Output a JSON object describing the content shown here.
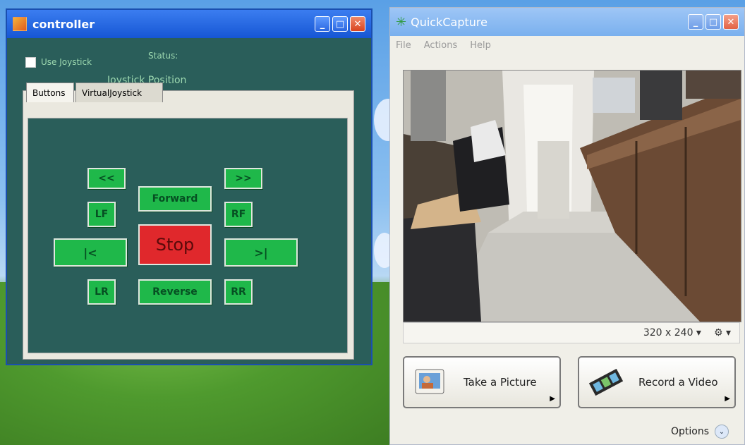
{
  "controller": {
    "title": "controller",
    "use_joystick_label": "Use Joystick",
    "status_label": "Status:",
    "joystick_position_label": "Joystick Position",
    "tabs": [
      "Buttons",
      "VirtualJoystick"
    ],
    "buttons": {
      "rewind": "<<",
      "fast_forward": ">>",
      "forward": "Forward",
      "lf": "LF",
      "rf": "RF",
      "left": "|<",
      "stop": "Stop",
      "right": ">|",
      "lr": "LR",
      "reverse": "Reverse",
      "rr": "RR"
    }
  },
  "quickcapture": {
    "title": "QuickCapture",
    "menu": [
      "File",
      "Actions",
      "Help"
    ],
    "resolution": "320 x 240",
    "take_picture": "Take a Picture",
    "record_video": "Record a Video",
    "options": "Options"
  }
}
